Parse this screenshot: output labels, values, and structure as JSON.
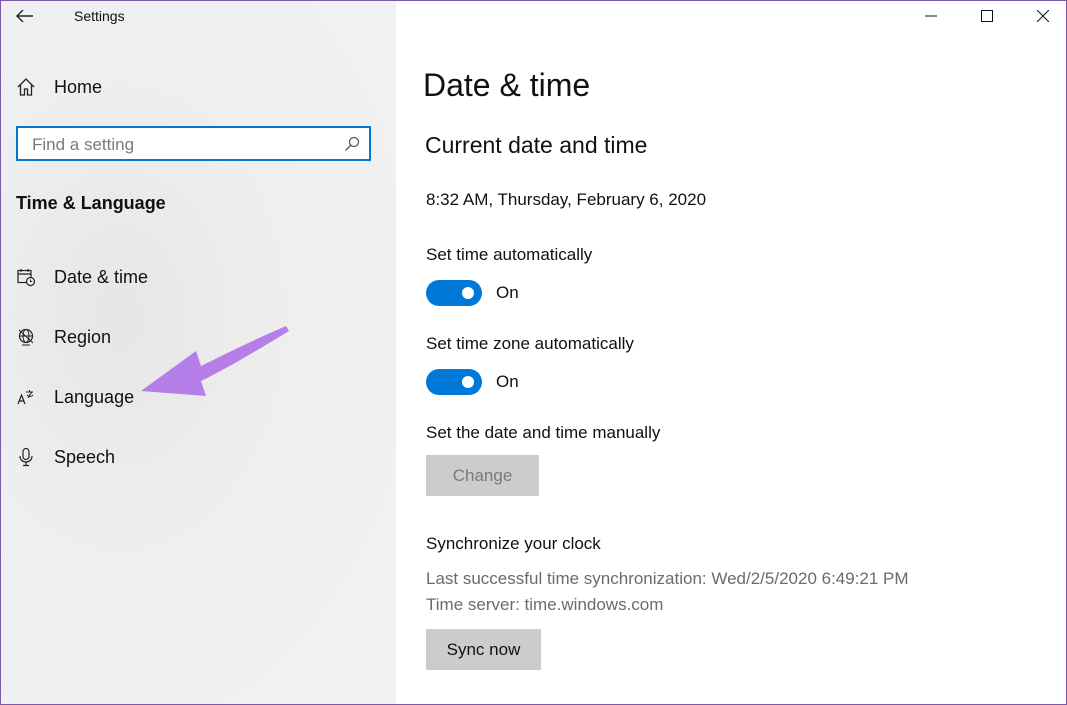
{
  "window": {
    "title": "Settings",
    "controls": {
      "minimize": "minimize-icon",
      "maximize": "maximize-icon",
      "close": "close-icon"
    }
  },
  "sidebar": {
    "home_label": "Home",
    "search": {
      "placeholder": "Find a setting"
    },
    "section_title": "Time & Language",
    "items": [
      {
        "label": "Date & time",
        "icon": "calendar-clock-icon"
      },
      {
        "label": "Region",
        "icon": "globe-icon"
      },
      {
        "label": "Language",
        "icon": "language-icon"
      },
      {
        "label": "Speech",
        "icon": "microphone-icon"
      }
    ],
    "annotation_arrow_color": "#b57ee8"
  },
  "main": {
    "title": "Date & time",
    "current_heading": "Current date and time",
    "current_value": "8:32 AM, Thursday, February 6, 2020",
    "set_time_auto": {
      "label": "Set time automatically",
      "state": "On"
    },
    "set_zone_auto": {
      "label": "Set time zone automatically",
      "state": "On"
    },
    "manual": {
      "label": "Set the date and time manually",
      "button": "Change"
    },
    "sync": {
      "heading": "Synchronize your clock",
      "last_sync": "Last successful time synchronization: Wed/2/5/2020 6:49:21 PM",
      "server": "Time server: time.windows.com",
      "button": "Sync now"
    }
  },
  "colors": {
    "accent": "#0078d7",
    "border": "#7a5aa6"
  }
}
